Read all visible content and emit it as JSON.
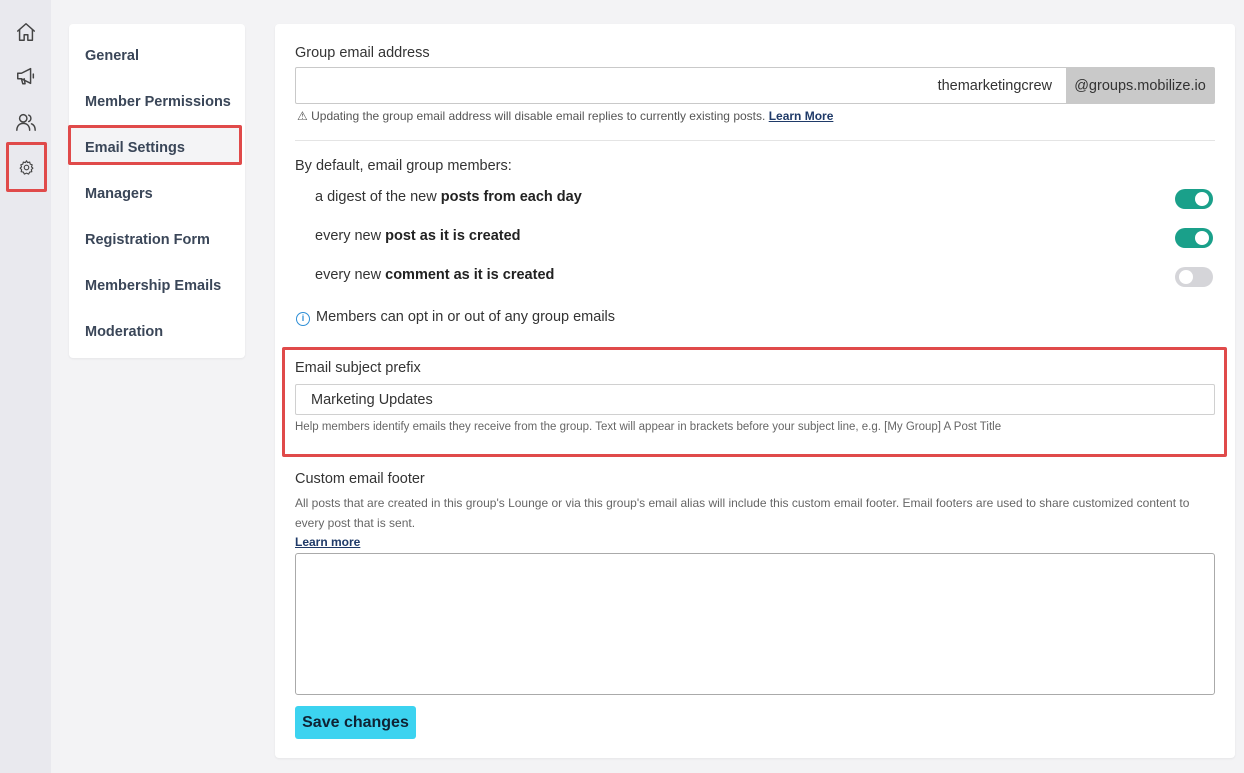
{
  "rail": {
    "icons": [
      "home-icon",
      "megaphone-icon",
      "people-icon",
      "gear-icon"
    ]
  },
  "subnav": {
    "items": [
      {
        "label": "General"
      },
      {
        "label": "Member Permissions"
      },
      {
        "label": "Email Settings"
      },
      {
        "label": "Managers"
      },
      {
        "label": "Registration Form"
      },
      {
        "label": "Membership Emails"
      },
      {
        "label": "Moderation"
      }
    ],
    "active_index": 2
  },
  "group_email": {
    "label": "Group email address",
    "value": "themarketingcrew",
    "suffix": "@groups.mobilize.io",
    "warning_icon": "⚠",
    "warning": "Updating the group email address will disable email replies to currently existing posts.",
    "learn_more": "Learn More"
  },
  "defaults": {
    "heading": "By default, email group members:",
    "rows": [
      {
        "prefix": "a digest of the new ",
        "bold": "posts from each day",
        "on": true
      },
      {
        "prefix": "every new ",
        "bold": "post as it is created",
        "on": true
      },
      {
        "prefix": "every new ",
        "bold": "comment as it is created",
        "on": false
      }
    ],
    "info_icon": "i",
    "info": "Members can opt in or out of any group emails"
  },
  "subject_prefix": {
    "label": "Email subject prefix",
    "value": "Marketing Updates",
    "help": "Help members identify emails they receive from the group. Text will appear in brackets before your subject line, e.g. [My Group] A Post Title"
  },
  "footer": {
    "label": "Custom email footer",
    "description": "All posts that are created in this group's Lounge or via this group's email alias will include this custom email footer. Email footers are used to share customized content to every post that is sent.",
    "learn_more": "Learn more",
    "value": ""
  },
  "save_label": "Save changes",
  "colors": {
    "toggle_on": "#1aa08a",
    "toggle_off": "#d5d5d9",
    "save_button": "#3cd3f0",
    "highlight": "#e04a4a"
  }
}
